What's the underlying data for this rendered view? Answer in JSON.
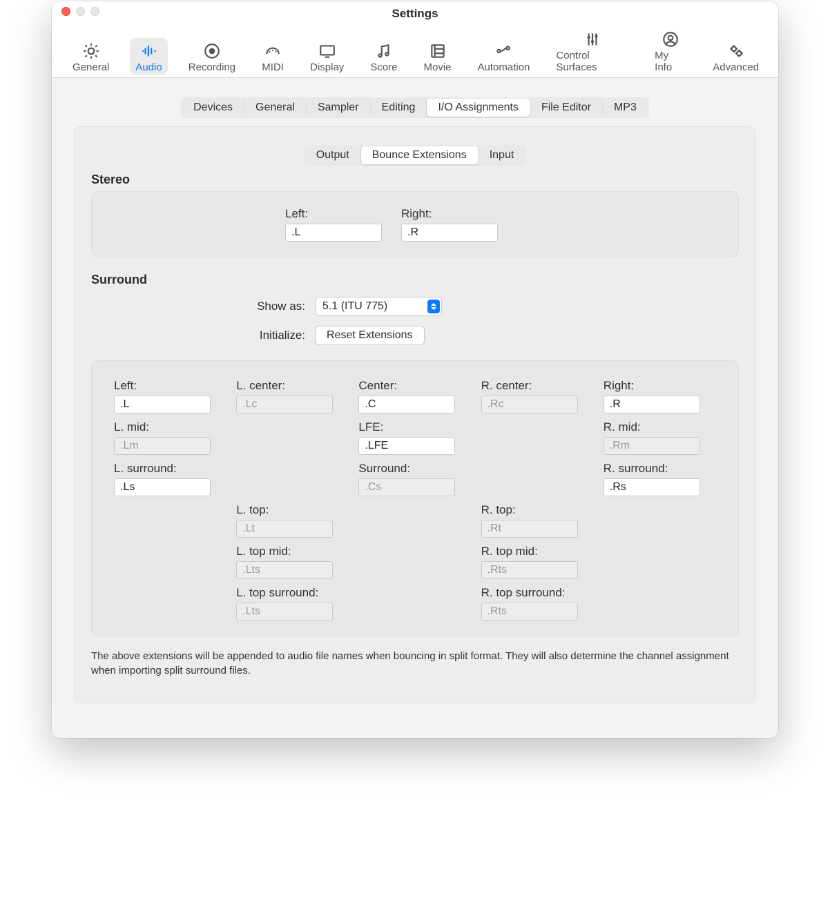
{
  "window": {
    "title": "Settings"
  },
  "toolbar": {
    "items": [
      {
        "label": "General"
      },
      {
        "label": "Audio"
      },
      {
        "label": "Recording"
      },
      {
        "label": "MIDI"
      },
      {
        "label": "Display"
      },
      {
        "label": "Score"
      },
      {
        "label": "Movie"
      },
      {
        "label": "Automation"
      },
      {
        "label": "Control Surfaces"
      },
      {
        "label": "My Info"
      },
      {
        "label": "Advanced"
      }
    ],
    "selected": 1
  },
  "tabs1": {
    "items": [
      "Devices",
      "General",
      "Sampler",
      "Editing",
      "I/O Assignments",
      "File Editor",
      "MP3"
    ],
    "selected": 4
  },
  "tabs2": {
    "items": [
      "Output",
      "Bounce Extensions",
      "Input"
    ],
    "selected": 1
  },
  "stereo": {
    "heading": "Stereo",
    "left_label": "Left:",
    "left_value": ".L",
    "right_label": "Right:",
    "right_value": ".R"
  },
  "surround": {
    "heading": "Surround",
    "show_as_label": "Show as:",
    "show_as_value": "5.1 (ITU 775)",
    "initialize_label": "Initialize:",
    "reset_button": "Reset Extensions",
    "grid": [
      [
        {
          "label": "Left:",
          "value": ".L",
          "enabled": true
        },
        {
          "label": "L. center:",
          "value": ".Lc",
          "enabled": false
        },
        {
          "label": "Center:",
          "value": ".C",
          "enabled": true
        },
        {
          "label": "R. center:",
          "value": ".Rc",
          "enabled": false
        },
        {
          "label": "Right:",
          "value": ".R",
          "enabled": true
        }
      ],
      [
        {
          "label": "L. mid:",
          "value": ".Lm",
          "enabled": false
        },
        null,
        {
          "label": "LFE:",
          "value": ".LFE",
          "enabled": true
        },
        null,
        {
          "label": "R. mid:",
          "value": ".Rm",
          "enabled": false
        }
      ],
      [
        {
          "label": "L. surround:",
          "value": ".Ls",
          "enabled": true
        },
        null,
        {
          "label": "Surround:",
          "value": ".Cs",
          "enabled": false
        },
        null,
        {
          "label": "R. surround:",
          "value": ".Rs",
          "enabled": true
        }
      ],
      [
        null,
        {
          "label": "L. top:",
          "value": ".Lt",
          "enabled": false
        },
        null,
        {
          "label": "R. top:",
          "value": ".Rt",
          "enabled": false
        },
        null
      ],
      [
        null,
        {
          "label": "L. top mid:",
          "value": ".Lts",
          "enabled": false
        },
        null,
        {
          "label": "R. top mid:",
          "value": ".Rts",
          "enabled": false
        },
        null
      ],
      [
        null,
        {
          "label": "L. top surround:",
          "value": ".Lts",
          "enabled": false
        },
        null,
        {
          "label": "R. top surround:",
          "value": ".Rts",
          "enabled": false
        },
        null
      ]
    ]
  },
  "note": "The above extensions will be appended to audio file names when bouncing in split format. They will also determine the channel assignment when importing split surround files."
}
